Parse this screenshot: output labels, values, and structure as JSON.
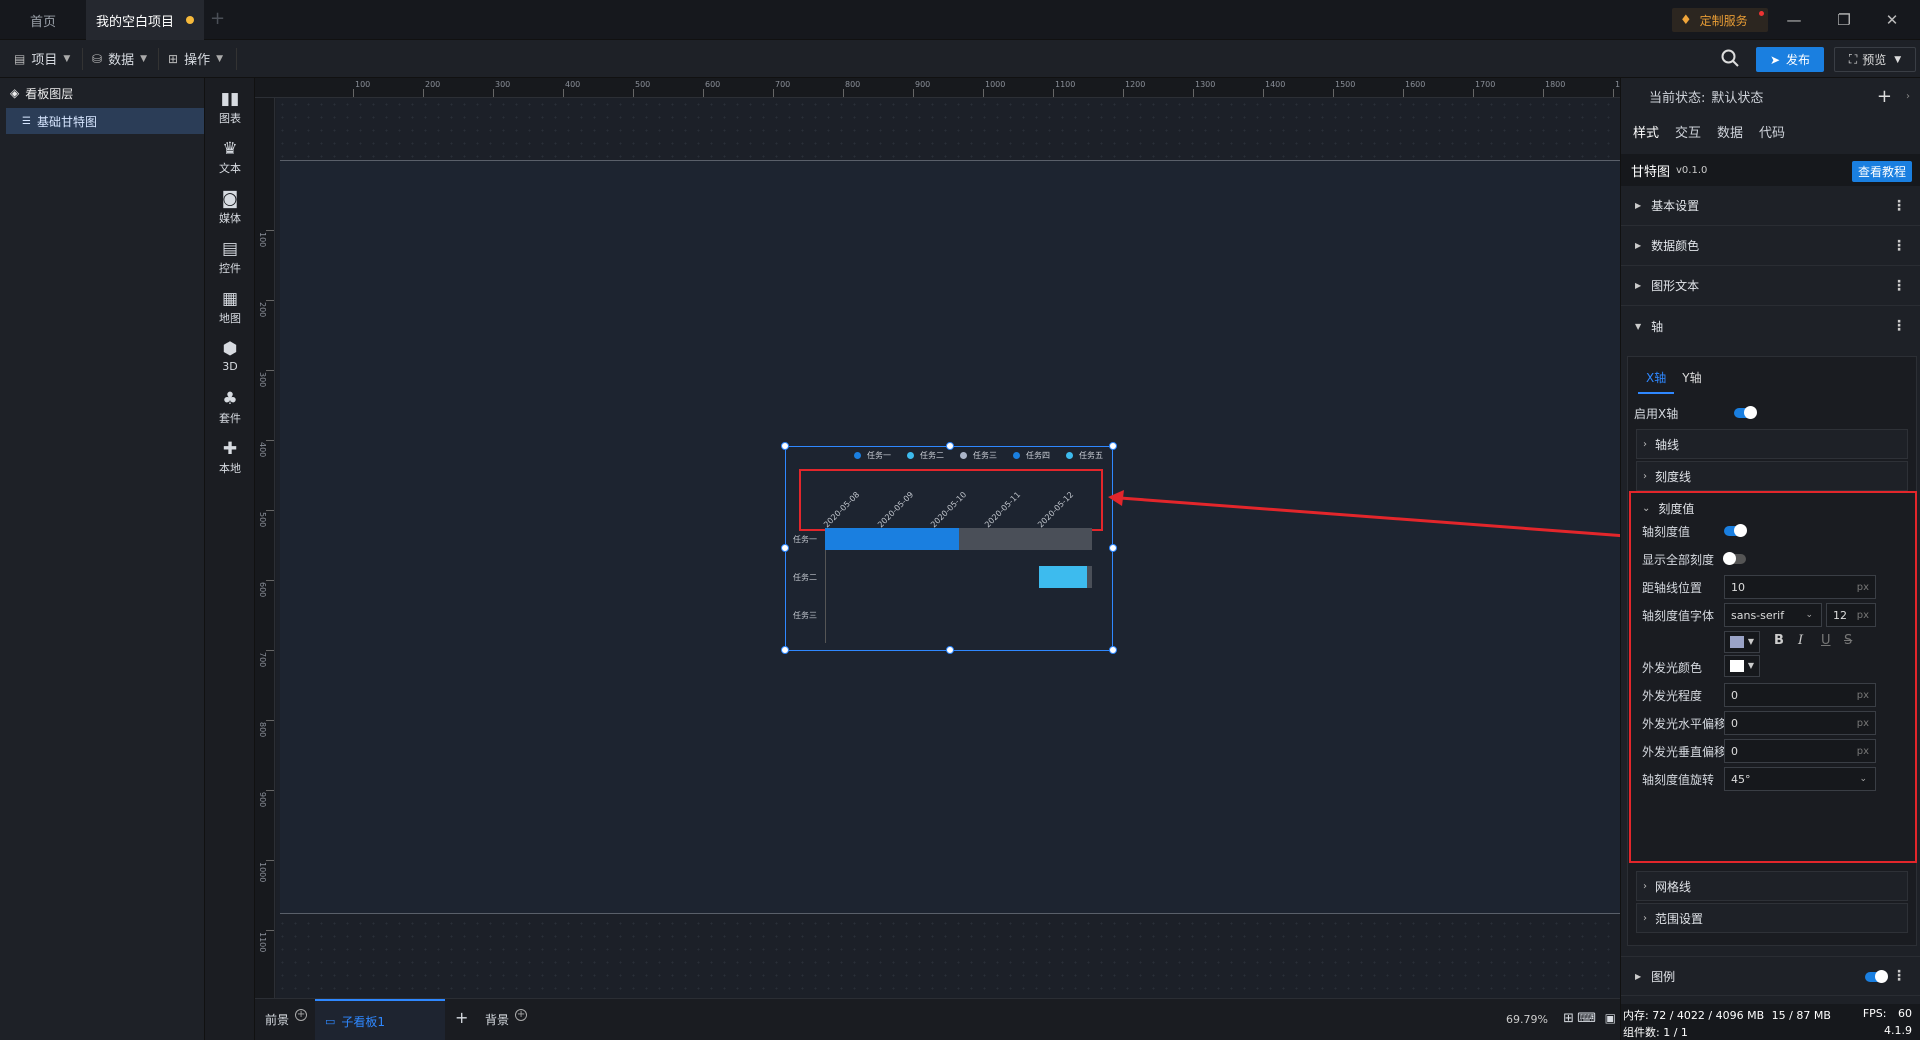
{
  "titlebar": {
    "tabs": [
      "首页",
      "我的空白项目"
    ],
    "custom_service": "定制服务",
    "win_min": "—",
    "win_max": "❐",
    "win_close": "✕"
  },
  "menubar": {
    "menus": [
      "项目",
      "数据",
      "操作"
    ],
    "publish": "发布",
    "preview": "预览"
  },
  "layers": {
    "title": "看板图层",
    "items": [
      "基础甘特图"
    ]
  },
  "tools": [
    "图表",
    "文本",
    "媒体",
    "控件",
    "地图",
    "3D",
    "套件",
    "本地"
  ],
  "ruler": {
    "h_ticks": [
      "100",
      "200",
      "300",
      "400",
      "500",
      "600",
      "700",
      "800",
      "900",
      "1000",
      "1100",
      "1200",
      "1300",
      "1400",
      "1500",
      "1600",
      "1700",
      "1800",
      "1900"
    ],
    "v_ticks": [
      "100",
      "200",
      "300",
      "400",
      "500",
      "600",
      "700",
      "800",
      "900",
      "1000",
      "1100"
    ]
  },
  "chart_data": {
    "type": "bar",
    "legend": [
      "任务一",
      "任务二",
      "任务三",
      "任务四",
      "任务五"
    ],
    "legend_colors": [
      "#1a7fe0",
      "#3dbbee",
      "#aab4c8",
      "#1a7fe0",
      "#3dbbee"
    ],
    "x_ticks": [
      "2020-05-08",
      "2020-05-09",
      "2020-05-10",
      "2020-05-11",
      "2020-05-12"
    ],
    "categories": [
      "任务一",
      "任务二",
      "任务三"
    ],
    "tasks": [
      {
        "name": "任务一",
        "start": 0.0,
        "progress_end": 2.5,
        "end": 5.0
      },
      {
        "name": "任务二",
        "start": 4.0,
        "progress_end": 4.9,
        "end": 5.0
      }
    ],
    "x_range": [
      0,
      5
    ],
    "tick_rotate": "45°",
    "colors": {
      "progress": "#1a7fe0",
      "remaining": "#4a4f58",
      "task2": "#3dbbee"
    }
  },
  "bottombar": {
    "foreground": "前景",
    "subboard": "子看板1",
    "background": "背景",
    "zoom": "69.79%"
  },
  "panel": {
    "state_label": "当前状态:",
    "state_value": "默认状态",
    "tabs": [
      "样式",
      "交互",
      "数据",
      "代码"
    ],
    "component": "甘特图",
    "version": "v0.1.0",
    "tutorial": "查看教程",
    "sections": [
      "基本设置",
      "数据颜色",
      "图形文本",
      "轴"
    ],
    "axis_tabs": [
      "X轴",
      "Y轴"
    ],
    "enable_x": "启用X轴",
    "axis_line": "轴线",
    "tick_line": "刻度线",
    "tick_value": "刻度值",
    "axis_tick_value": "轴刻度值",
    "show_all_ticks": "显示全部刻度",
    "distance": "距轴线位置",
    "distance_value": "10",
    "font": "轴刻度值字体",
    "font_family": "sans-serif",
    "font_size": "12",
    "unit": "px",
    "glow_color": "外发光颜色",
    "glow_level": "外发光程度",
    "glow_level_value": "0",
    "glow_h": "外发光水平偏移",
    "glow_h_value": "0",
    "glow_v": "外发光垂直偏移",
    "glow_v_value": "0",
    "rotate": "轴刻度值旋转",
    "rotate_value": "45°",
    "grid": "网格线",
    "range": "范围设置",
    "legend": "图例",
    "fmt": [
      "B",
      "I",
      "U",
      "S"
    ]
  },
  "status": {
    "memory_label": "内存:",
    "memory": "72 / 4022 / 4096 MB",
    "mem2": "15 / 87 MB",
    "fps_label": "FPS:",
    "fps": "60",
    "count_label": "组件数:",
    "count": "1 / 1",
    "version": "4.1.9"
  }
}
